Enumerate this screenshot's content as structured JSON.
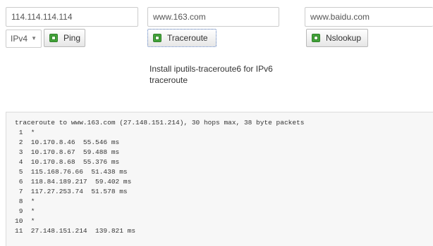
{
  "inputs": {
    "ipv4_host": "114.114.114.114",
    "traceroute_host": "www.163.com",
    "nslookup_host": "www.baidu.com"
  },
  "protocol": {
    "selected": "IPv4",
    "caret": "▼"
  },
  "buttons": {
    "ping": "Ping",
    "traceroute": "Traceroute",
    "nslookup": "Nslookup"
  },
  "note": "Install iputils-traceroute6 for IPv6 traceroute",
  "output": {
    "lines": [
      "traceroute to www.163.com (27.148.151.214), 30 hops max, 38 byte packets",
      " 1  *",
      " 2  10.170.8.46  55.546 ms",
      " 3  10.170.8.67  59.488 ms",
      " 4  10.170.8.68  55.376 ms",
      " 5  115.168.76.66  51.438 ms",
      " 6  118.84.189.217  59.402 ms",
      " 7  117.27.253.74  51.578 ms",
      " 8  *",
      " 9  *",
      "10  *",
      "11  27.148.151.214  139.821 ms"
    ]
  },
  "icons": {
    "button_icon": "green-square-icon"
  },
  "colors": {
    "background": "#ffffff",
    "output_background": "#f7f7f7",
    "icon_green": "#44a53a"
  }
}
